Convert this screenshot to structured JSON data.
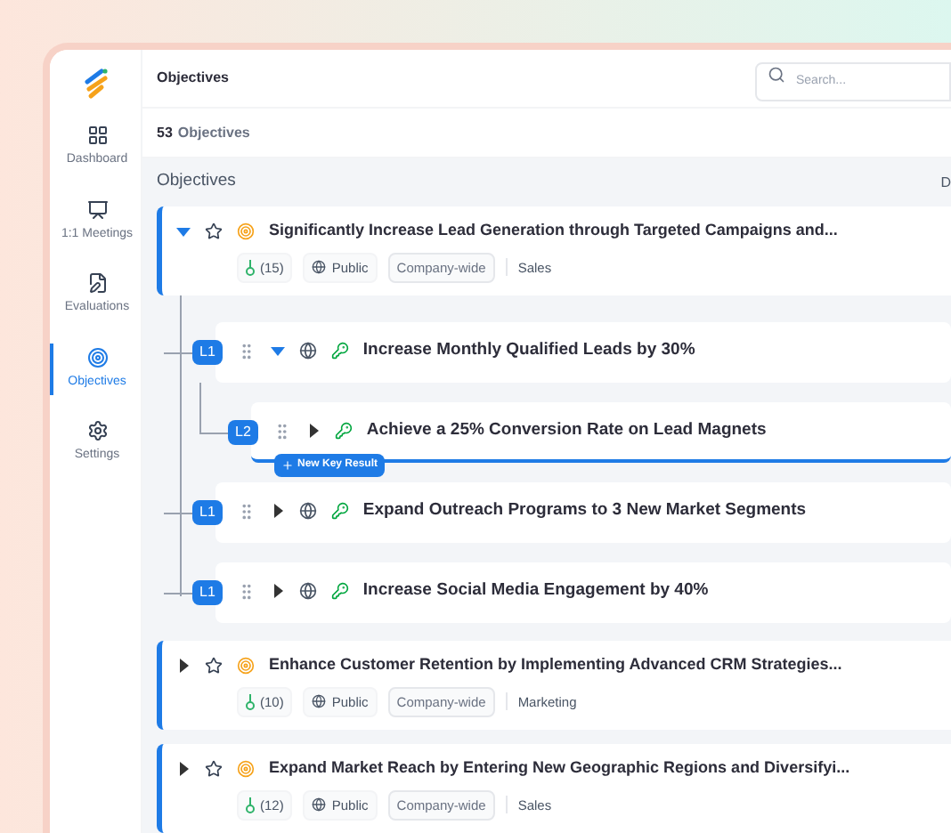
{
  "sidebar": {
    "items": [
      {
        "label": "Dashboard",
        "selected": false
      },
      {
        "label": "1:1 Meetings",
        "selected": false
      },
      {
        "label": "Evaluations",
        "selected": false
      },
      {
        "label": "Objectives",
        "selected": true
      },
      {
        "label": "Settings",
        "selected": false
      }
    ]
  },
  "header": {
    "title": "Objectives",
    "search": {
      "placeholder": "Search..."
    }
  },
  "count_bar": {
    "count": "53",
    "label": "Objectives"
  },
  "list": {
    "heading": "Objectives",
    "column_2": "D",
    "objectives": [
      {
        "title": "Significantly Increase Lead Generation through Targeted Campaigns and...",
        "expanded": true,
        "key_results": "(15)",
        "visibility": "Public",
        "scope": "Company-wide",
        "department": "Sales",
        "children": [
          {
            "badge": "L1",
            "title": "Increase Monthly Qualified Leads by 30%",
            "expanded": true,
            "public": true,
            "selected": false,
            "children": [
              {
                "badge": "L2",
                "title": "Achieve a 25% Conversion Rate on Lead Magnets",
                "expanded": false,
                "public": false,
                "selected": true,
                "new_button": "New Key Result"
              }
            ]
          },
          {
            "badge": "L1",
            "title": "Expand Outreach Programs to 3 New Market Segments",
            "expanded": false,
            "public": true,
            "selected": false
          },
          {
            "badge": "L1",
            "title": "Increase Social Media Engagement by 40%",
            "expanded": false,
            "public": true,
            "selected": false
          }
        ]
      },
      {
        "title": "Enhance Customer Retention by Implementing Advanced CRM Strategies...",
        "expanded": false,
        "key_results": "(10)",
        "visibility": "Public",
        "scope": "Company-wide",
        "department": "Marketing"
      },
      {
        "title": "Expand Market Reach by Entering New Geographic Regions and Diversifyi...",
        "expanded": false,
        "key_results": "(12)",
        "visibility": "Public",
        "scope": "Company-wide",
        "department": "Sales"
      }
    ]
  }
}
